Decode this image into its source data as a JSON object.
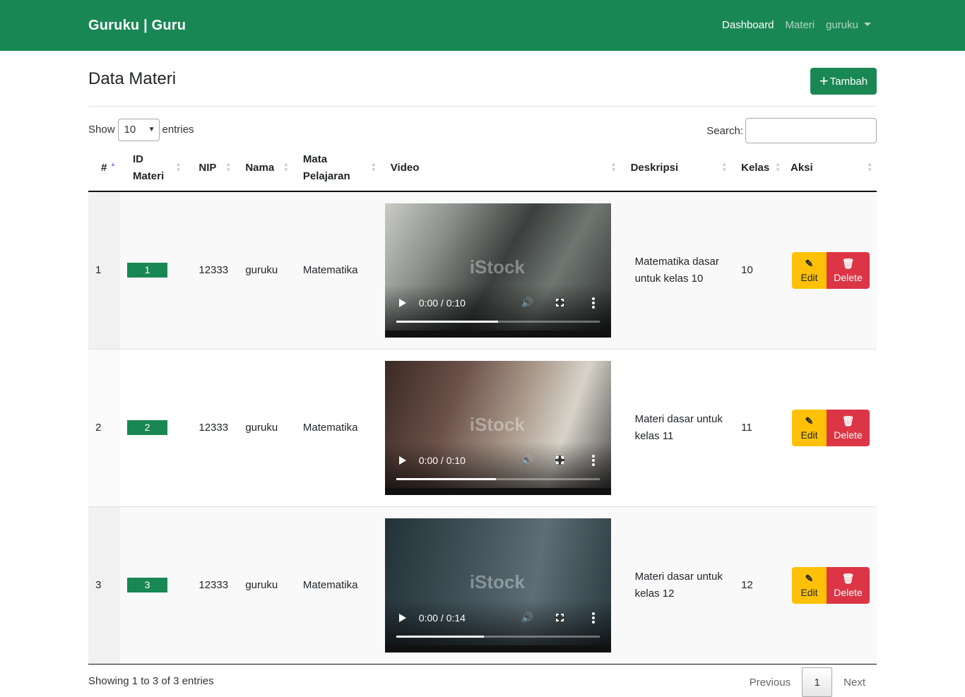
{
  "navbar": {
    "brand": "Guruku | Guru",
    "links": [
      {
        "label": "Dashboard",
        "active": true
      },
      {
        "label": "Materi",
        "active": false
      }
    ],
    "user_dropdown": "guruku"
  },
  "page": {
    "title": "Data Materi",
    "add_button": "Tambah",
    "add_icon": "plus-icon"
  },
  "table_controls": {
    "show_label": "Show",
    "entries_value": "10",
    "entries_label": "entries",
    "search_label": "Search:",
    "search_value": ""
  },
  "table": {
    "headers": [
      {
        "line1": "#",
        "line2": ""
      },
      {
        "line1": "ID",
        "line2": "Materi"
      },
      {
        "line1": "NIP",
        "line2": ""
      },
      {
        "line1": "Nama",
        "line2": ""
      },
      {
        "line1": "Mata",
        "line2": "Pelajaran"
      },
      {
        "line1": "Video",
        "line2": ""
      },
      {
        "line1": "Deskripsi",
        "line2": ""
      },
      {
        "line1": "Kelas",
        "line2": ""
      },
      {
        "line1": "Aksi",
        "line2": ""
      }
    ],
    "sorted_column": "#",
    "sort_direction": "ascending",
    "rows": [
      {
        "no": "1",
        "id_materi": "1",
        "nip": "12333",
        "nama": "guruku",
        "mata_pelajaran": "Matematika",
        "video": {
          "time": "0:00 / 0:10",
          "progress": 0.5,
          "watermark": "iStock"
        },
        "deskripsi_line1": "Matematika dasar",
        "deskripsi_line2": "untuk kelas 10",
        "kelas": "10",
        "edit_label": "Edit",
        "delete_label": "Delete"
      },
      {
        "no": "2",
        "id_materi": "2",
        "nip": "12333",
        "nama": "guruku",
        "mata_pelajaran": "Matematika",
        "video": {
          "time": "0:00 / 0:10",
          "progress": 0.49,
          "watermark": "iStock"
        },
        "deskripsi_line1": "Materi dasar untuk",
        "deskripsi_line2": "kelas 11",
        "kelas": "11",
        "edit_label": "Edit",
        "delete_label": "Delete"
      },
      {
        "no": "3",
        "id_materi": "3",
        "nip": "12333",
        "nama": "guruku",
        "mata_pelajaran": "Matematika",
        "video": {
          "time": "0:00 / 0:14",
          "progress": 0.43,
          "watermark": "iStock"
        },
        "deskripsi_line1": "Materi dasar untuk",
        "deskripsi_line2": "kelas 12",
        "kelas": "12",
        "edit_label": "Edit",
        "delete_label": "Delete"
      }
    ]
  },
  "footer": {
    "info": "Showing 1 to 3 of 3 entries",
    "previous": "Previous",
    "current_page": "1",
    "next": "Next"
  },
  "colors": {
    "primary": "#198754",
    "edit": "#ffc107",
    "delete": "#dc3545"
  }
}
